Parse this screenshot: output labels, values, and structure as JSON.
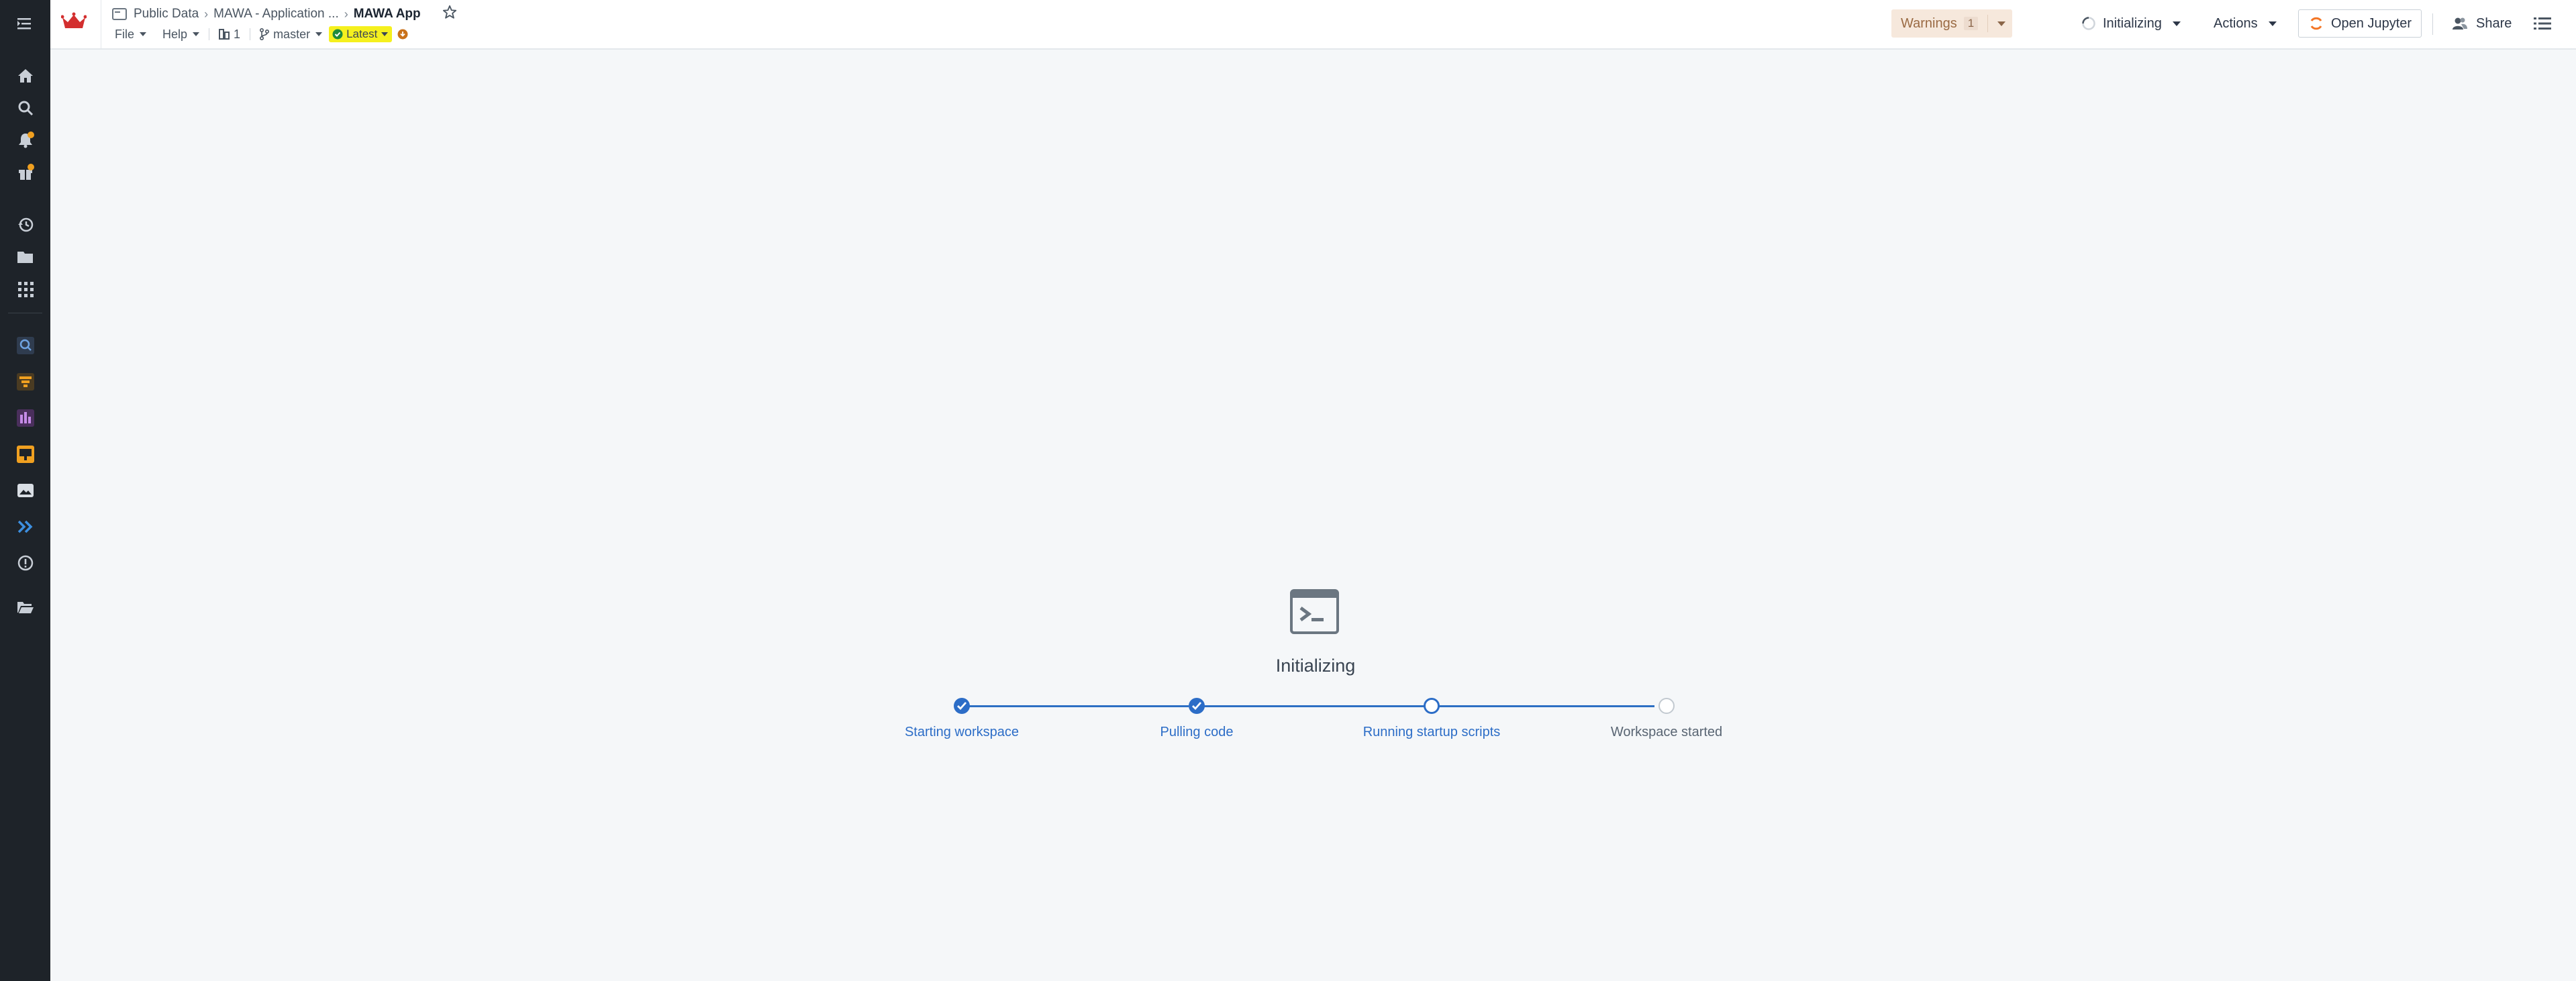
{
  "breadcrumb": {
    "items": [
      "Public Data",
      "MAWA - Application ..."
    ],
    "current": "MAWA App"
  },
  "menu": {
    "file": "File",
    "help": "Help",
    "pr_count": "1",
    "branch": "master",
    "version": "Latest"
  },
  "header_right": {
    "warnings_label": "Warnings",
    "warnings_count": "1",
    "status": "Initializing",
    "actions": "Actions",
    "open_jupyter": "Open Jupyter",
    "share": "Share"
  },
  "workspace": {
    "title": "Initializing",
    "steps": [
      {
        "label": "Starting workspace",
        "state": "done"
      },
      {
        "label": "Pulling code",
        "state": "done"
      },
      {
        "label": "Running startup scripts",
        "state": "active"
      },
      {
        "label": "Workspace started",
        "state": "pending"
      }
    ]
  },
  "colors": {
    "accent": "#2c6dc7",
    "rail": "#1e2329",
    "brand": "#d32f2f",
    "highlight": "#f5f01e",
    "warning_bg": "#f6e8dc"
  }
}
